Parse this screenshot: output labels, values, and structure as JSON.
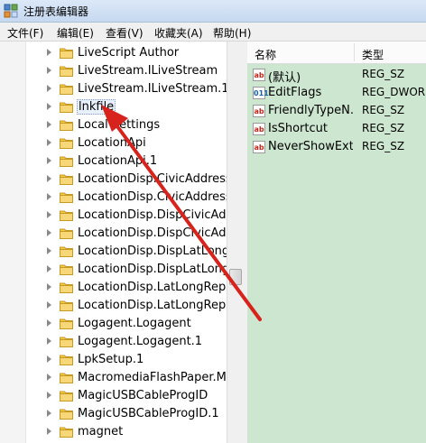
{
  "window": {
    "title": "注册表编辑器"
  },
  "menu": [
    {
      "label": "文件(F)"
    },
    {
      "label": "编辑(E)"
    },
    {
      "label": "查看(V)"
    },
    {
      "label": "收藏夹(A)"
    },
    {
      "label": "帮助(H)"
    }
  ],
  "tree": {
    "items": [
      {
        "label": "LiveScript Author"
      },
      {
        "label": "LiveStream.ILiveStream"
      },
      {
        "label": "LiveStream.ILiveStream.1"
      },
      {
        "label": "lnkfile",
        "selected": true
      },
      {
        "label": "Local Settings"
      },
      {
        "label": "LocationApi"
      },
      {
        "label": "LocationApi.1"
      },
      {
        "label": "LocationDisp.CivicAddressRe"
      },
      {
        "label": "LocationDisp.CivicAddressRe"
      },
      {
        "label": "LocationDisp.DispCivicAddre"
      },
      {
        "label": "LocationDisp.DispCivicAddre"
      },
      {
        "label": "LocationDisp.DispLatLongRe"
      },
      {
        "label": "LocationDisp.DispLatLongRe"
      },
      {
        "label": "LocationDisp.LatLongReport"
      },
      {
        "label": "LocationDisp.LatLongReport"
      },
      {
        "label": "Logagent.Logagent"
      },
      {
        "label": "Logagent.Logagent.1"
      },
      {
        "label": "LpkSetup.1"
      },
      {
        "label": "MacromediaFlashPaper.Mac"
      },
      {
        "label": "MagicUSBCableProgID"
      },
      {
        "label": "MagicUSBCableProgID.1"
      },
      {
        "label": "magnet"
      }
    ]
  },
  "values": {
    "columns": {
      "name": "名称",
      "type": "类型"
    },
    "rows": [
      {
        "icon": "string-value-icon",
        "icon_text": "ab",
        "name": "(默认)",
        "type": "REG_SZ"
      },
      {
        "icon": "binary-value-icon",
        "icon_text": "011",
        "name": "EditFlags",
        "type": "REG_DWORD"
      },
      {
        "icon": "string-value-icon",
        "icon_text": "ab",
        "name": "FriendlyTypeN...",
        "type": "REG_SZ"
      },
      {
        "icon": "string-value-icon",
        "icon_text": "ab",
        "name": "IsShortcut",
        "type": "REG_SZ"
      },
      {
        "icon": "string-value-icon",
        "icon_text": "ab",
        "name": "NeverShowExt",
        "type": "REG_SZ"
      }
    ]
  },
  "colors": {
    "values_background": "#cde6d0",
    "annotation_arrow": "#d8231c",
    "folder": "#f2c94c"
  }
}
